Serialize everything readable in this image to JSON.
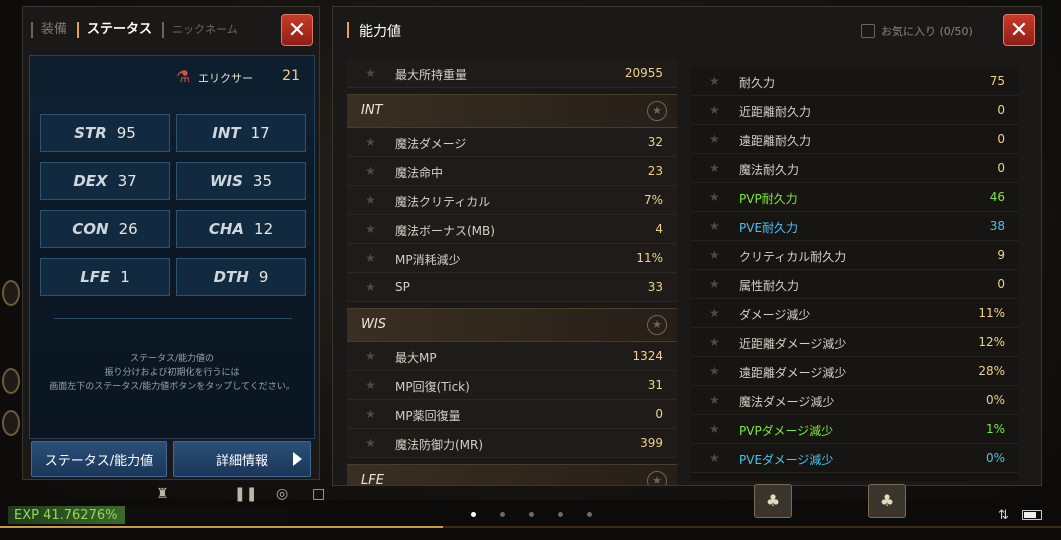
{
  "left_panel": {
    "tabs": [
      "装備",
      "ステータス",
      "ニックネーム"
    ],
    "elixir": {
      "label": "エリクサー",
      "value": "21"
    },
    "stats": [
      {
        "name": "STR",
        "value": "95"
      },
      {
        "name": "INT",
        "value": "17"
      },
      {
        "name": "DEX",
        "value": "37"
      },
      {
        "name": "WIS",
        "value": "35"
      },
      {
        "name": "CON",
        "value": "26"
      },
      {
        "name": "CHA",
        "value": "12"
      },
      {
        "name": "LFE",
        "value": "1"
      },
      {
        "name": "DTH",
        "value": "9"
      }
    ],
    "note_lines": [
      "ステータス/能力値の",
      "振り分けおよび初期化を行うには",
      "画面左下のステータス/能力値ボタンをタップしてください。"
    ],
    "buttons": {
      "status": "ステータス/能力値",
      "details": "詳細情報"
    },
    "close": "✕"
  },
  "right_panel": {
    "title": "能力値",
    "favorite_label": "お気に入り (0/50)",
    "close": "✕",
    "left_column": {
      "top_row": {
        "label": "最大所持重量",
        "value": "20955"
      },
      "sections": [
        {
          "title": "INT",
          "rows": [
            {
              "label": "魔法ダメージ",
              "value": "32"
            },
            {
              "label": "魔法命中",
              "value": "23"
            },
            {
              "label": "魔法クリティカル",
              "value": "7%"
            },
            {
              "label": "魔法ボーナス(MB)",
              "value": "4"
            },
            {
              "label": "MP消耗減少",
              "value": "11%"
            },
            {
              "label": "SP",
              "value": "33"
            }
          ]
        },
        {
          "title": "WIS",
          "rows": [
            {
              "label": "最大MP",
              "value": "1324"
            },
            {
              "label": "MP回復(Tick)",
              "value": "31"
            },
            {
              "label": "MP薬回復量",
              "value": "0"
            },
            {
              "label": "魔法防御力(MR)",
              "value": "399"
            }
          ]
        },
        {
          "title": "LFE",
          "rows": []
        }
      ]
    },
    "right_column": [
      {
        "label": "耐久力",
        "value": "75",
        "color": "normal"
      },
      {
        "label": "近距離耐久力",
        "value": "0",
        "color": "normal"
      },
      {
        "label": "遠距離耐久力",
        "value": "0",
        "color": "normal"
      },
      {
        "label": "魔法耐久力",
        "value": "0",
        "color": "normal"
      },
      {
        "label": "PVP耐久力",
        "value": "46",
        "color": "green"
      },
      {
        "label": "PVE耐久力",
        "value": "38",
        "color": "blue"
      },
      {
        "label": "クリティカル耐久力",
        "value": "9",
        "color": "normal"
      },
      {
        "label": "属性耐久力",
        "value": "0",
        "color": "normal"
      },
      {
        "label": "ダメージ減少",
        "value": "11%",
        "color": "normal"
      },
      {
        "label": "近距離ダメージ減少",
        "value": "12%",
        "color": "normal"
      },
      {
        "label": "遠距離ダメージ減少",
        "value": "28%",
        "color": "normal"
      },
      {
        "label": "魔法ダメージ減少",
        "value": "0%",
        "color": "normal"
      },
      {
        "label": "PVPダメージ減少",
        "value": "1%",
        "color": "green"
      },
      {
        "label": "PVEダメージ減少",
        "value": "0%",
        "color": "blue"
      }
    ]
  },
  "bottom_bar": {
    "exp_text": "EXP 41.76276%",
    "exp_fraction": 0.4176,
    "page_dots": 5,
    "active_dot": 0
  },
  "colors": {
    "accent": "#e2a34b",
    "value_gold": "#f0d28a",
    "pvp_green": "#7ee83f",
    "pve_blue": "#49c2f0",
    "button_blue": "#2b4f7a",
    "close_red": "#c93a2a"
  },
  "icons": [
    "elixir-potion-icon",
    "star-icon",
    "close-icon",
    "chevron-right-icon",
    "checkbox-icon",
    "battery-icon"
  ]
}
